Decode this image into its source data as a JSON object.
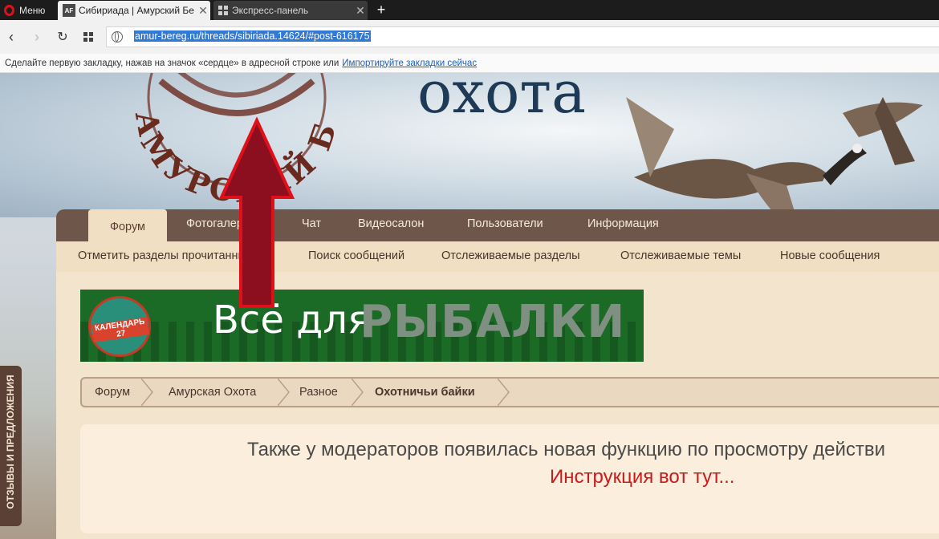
{
  "browser": {
    "menu_label": "Меню",
    "tabs": [
      {
        "label": "Сибириада | Амурский Бе"
      },
      {
        "label": "Экспресс-панель"
      }
    ],
    "url": "amur-bereg.ru/threads/sibiriada.14624/#post-616175",
    "bookmarks_hint": "Сделайте первую закладку, нажав на значок «сердце» в адресной строке или",
    "bookmarks_link": "Импортируйте закладки сейчас"
  },
  "header": {
    "site_title": "охота",
    "logo_text": "АМУРСКИЙ БЕРЕГ"
  },
  "nav": {
    "tabs": [
      "Форум",
      "Фотогалерея",
      "Чат",
      "Видеосалон",
      "Пользователи",
      "Информация"
    ],
    "subnav": [
      "Отметить разделы прочитанными",
      "Поиск сообщений",
      "Отслеживаемые разделы",
      "Отслеживаемые темы",
      "Новые сообщения"
    ]
  },
  "banner": {
    "badge": "КАЛЕНДАРЬ 27",
    "text1": "Всё для",
    "text2": "РЫБАЛКИ"
  },
  "breadcrumb": [
    "Форум",
    "Амурская Охота",
    "Разное",
    "Охотничьи байки"
  ],
  "notice": {
    "line1": "Также у модераторов появилась новая функцию по просмотру действи",
    "line2": "Инструкция вот тут..."
  },
  "sidebar": {
    "feedback": "ОТЗЫВЫ И ПРЕДЛОЖЕНИЯ"
  },
  "colors": {
    "nav_bg": "#6e564a",
    "link_red": "#c91b1b",
    "annotation_arrow": "#8b0f1e"
  }
}
